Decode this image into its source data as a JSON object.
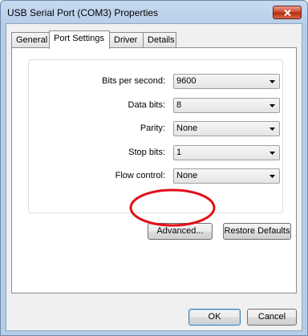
{
  "window": {
    "title": "USB Serial Port (COM3) Properties"
  },
  "tabs": [
    {
      "label": "General"
    },
    {
      "label": "Port Settings",
      "active": true
    },
    {
      "label": "Driver"
    },
    {
      "label": "Details"
    }
  ],
  "settings": {
    "bits_per_second": {
      "label": "Bits per second:",
      "value": "9600"
    },
    "data_bits": {
      "label": "Data bits:",
      "value": "8"
    },
    "parity": {
      "label": "Parity:",
      "value": "None"
    },
    "stop_bits": {
      "label": "Stop bits:",
      "value": "1"
    },
    "flow_control": {
      "label": "Flow control:",
      "value": "None"
    }
  },
  "buttons": {
    "advanced": "Advanced...",
    "restore_defaults": "Restore Defaults",
    "ok": "OK",
    "cancel": "Cancel"
  },
  "colors": {
    "highlight_ellipse": "#e0101a",
    "close_button": "#c9432a"
  }
}
